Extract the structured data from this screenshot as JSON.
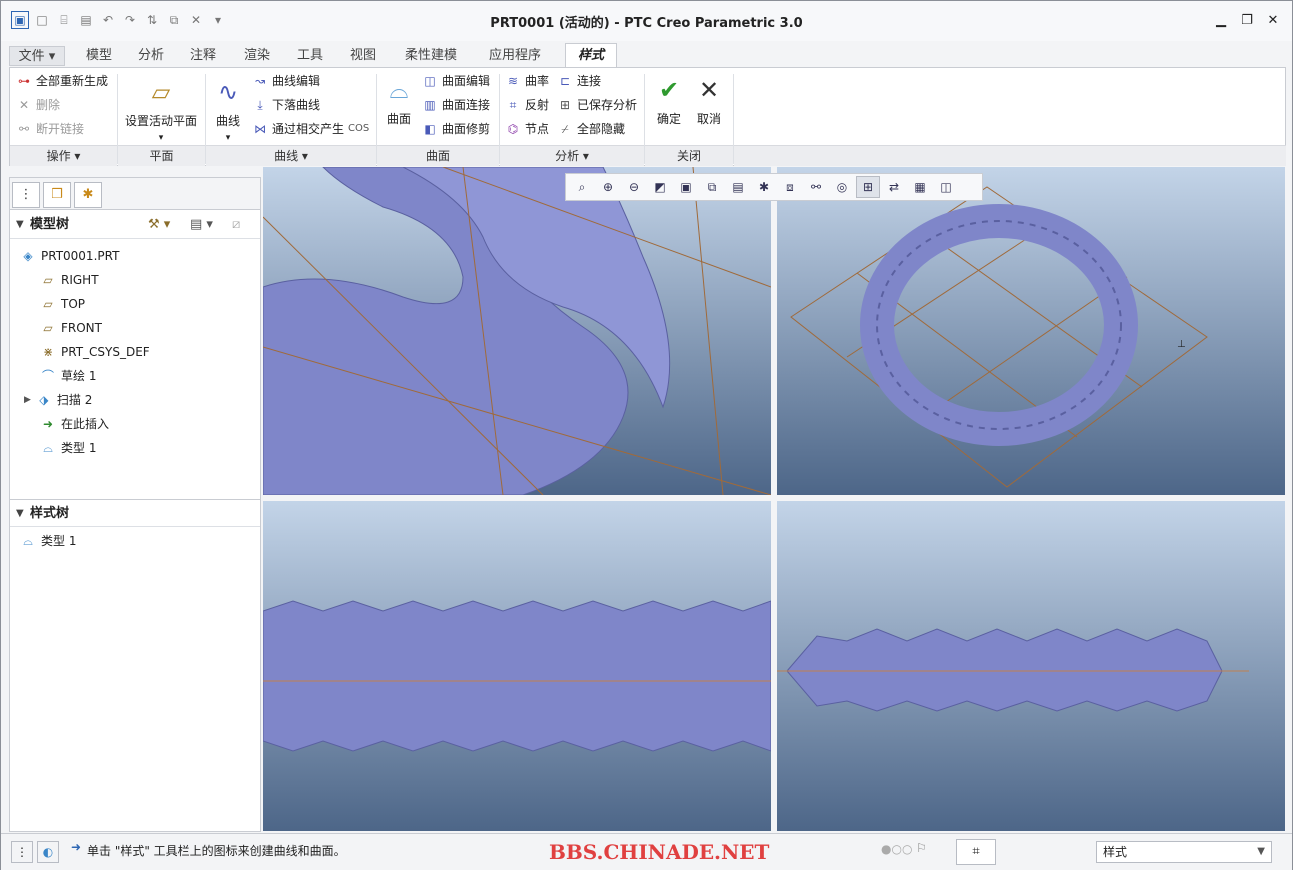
{
  "title": "PRT0001 (活动的) - PTC Creo Parametric 3.0",
  "quick_access": [
    "new-icon",
    "open-icon",
    "save-icon",
    "undo-icon",
    "redo-icon",
    "regenerate-icon",
    "windows-icon",
    "close-window-icon",
    "more-icon"
  ],
  "tabs": [
    "文件",
    "模型",
    "分析",
    "注释",
    "渲染",
    "工具",
    "视图",
    "柔性建模",
    "应用程序",
    "样式"
  ],
  "ribbon": {
    "ops": {
      "regen_all": "全部重新生成",
      "delete": "删除",
      "disconnect": "断开链接",
      "label": "操作"
    },
    "plane": {
      "set_active": "设置活动平面",
      "label": "平面"
    },
    "curves": {
      "curve": "曲线",
      "curve_edit": "曲线编辑",
      "drop_curve": "下落曲线",
      "cos": "通过相交产生",
      "cos_tag": "COS",
      "label": "曲线"
    },
    "surfaces": {
      "surface": "曲面",
      "surface_edit": "曲面编辑",
      "surface_connect": "曲面连接",
      "surface_trim": "曲面修剪",
      "label": "曲面"
    },
    "analysis": {
      "curvature": "曲率",
      "connect": "连接",
      "reflect": "反射",
      "saved": "已保存分析",
      "node": "节点",
      "hide_all": "全部隐藏",
      "label": "分析"
    },
    "close": {
      "ok": "确定",
      "cancel": "取消",
      "label": "关闭"
    }
  },
  "model_tree": {
    "title": "模型树",
    "items": [
      "PRT0001.PRT",
      "RIGHT",
      "TOP",
      "FRONT",
      "PRT_CSYS_DEF",
      "草绘 1",
      "扫描 2",
      "在此插入",
      "类型 1"
    ]
  },
  "style_tree": {
    "title": "样式树",
    "items": [
      "类型 1"
    ]
  },
  "status": {
    "message": "单击 \"样式\" 工具栏上的图标来创建曲线和曲面。",
    "watermark": "BBS.CHINADE.NET",
    "filter": "样式"
  },
  "colors": {
    "accent": "#2e66b3",
    "surface": "#7f86c9",
    "background_top": "#c3d4e8",
    "background_bottom": "#4d6688"
  }
}
